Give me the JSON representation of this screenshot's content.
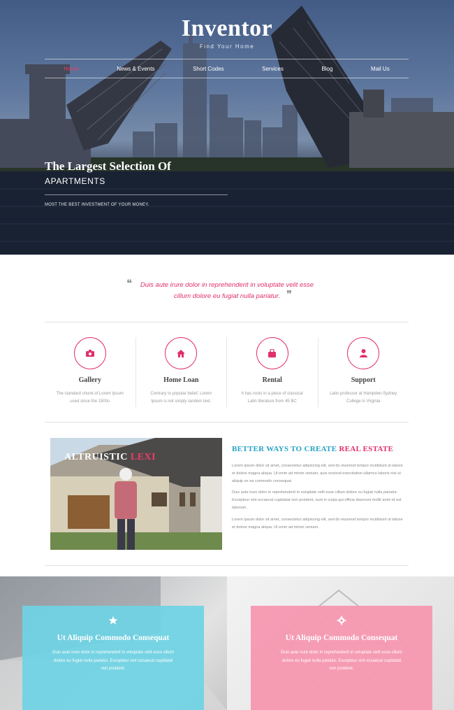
{
  "brand": {
    "name": "Inventor",
    "tagline": "Find Your Home"
  },
  "nav": {
    "items": [
      "Home",
      "News & Events",
      "Short Codes",
      "Services",
      "Blog",
      "Mail Us"
    ],
    "active": 0
  },
  "hero": {
    "title": "The Largest Selection Of",
    "subtitle": "APARTMENTS",
    "tagline": "MOST THE BEST INVESTMENT OF YOUR MONEY."
  },
  "quote": {
    "line1": "Duis aute irure dolor in reprehenderit in voluptate velit esse",
    "line2": "cillum dolore eu fugiat nulla pariatur."
  },
  "services": [
    {
      "title": "Gallery",
      "desc": "The standard chunk of Lorem Ipsum used since the 1500s",
      "icon": "camera-icon"
    },
    {
      "title": "Home Loan",
      "desc": "Contrary to popular belief, Lorem Ipsum is not simply random text.",
      "icon": "home-icon"
    },
    {
      "title": "Rental",
      "desc": "It has roots in a piece of classical Latin literature from 45 BC",
      "icon": "shopping-bag-icon"
    },
    {
      "title": "Support",
      "desc": "Latin professor at Hampden-Sydney College in Virginia",
      "icon": "user-icon"
    }
  ],
  "about": {
    "image_caption_part1": "ALTRUISTIC",
    "image_caption_part2": "LEXI",
    "title_part1": "BETTER WAYS TO CREATE",
    "title_part2": "REAL ESTATE",
    "paragraphs": [
      "Lorem ipsum dolor sit amet, consectetur adipiscing elit, sed do eiusmod tempor incididunt ut labore et dolore magna aliqua. Ut enim ad minim veniam, quis nostrud exercitation ullamco laboris nisi ut aliquip ex ea commodo consequat.",
      "Duis aute irure dolor in reprehenderit in voluptate velit esse cillum dolore eu fugiat nulla pariatur. Excepteur sint occaecat cupidatat non proident, sunt in culpa qui officia deserunt mollit anim id est laborum.",
      "Lorem ipsum dolor sit amet, consectetur adipiscing elit, sed do eiusmod tempor incididunt ut labore et dolore magna aliqua. Ut enim ad minim veniam."
    ]
  },
  "cards": [
    {
      "title": "Ut Aliquip Commodo Consequat",
      "desc": "Duis aute irure dolor in reprehenderit in voluptate velit esse cillum dolore eu fugiat nulla pariatur. Excepteur sint occaecat cupidatat non proident.",
      "icon": "star-icon",
      "color": "#6fd3e4"
    },
    {
      "title": "Ut Aliquip Commodo Consequat",
      "desc": "Duis aute irure dolor in reprehenderit in voluptate velit esse cillum dolore eu fugiat nulla pariatur. Excepteur sint occaecat cupidatat non proident.",
      "icon": "gear-icon",
      "color": "#f698b0"
    }
  ],
  "colors": {
    "accent": "#e0306a",
    "teal": "#25a3c4"
  }
}
